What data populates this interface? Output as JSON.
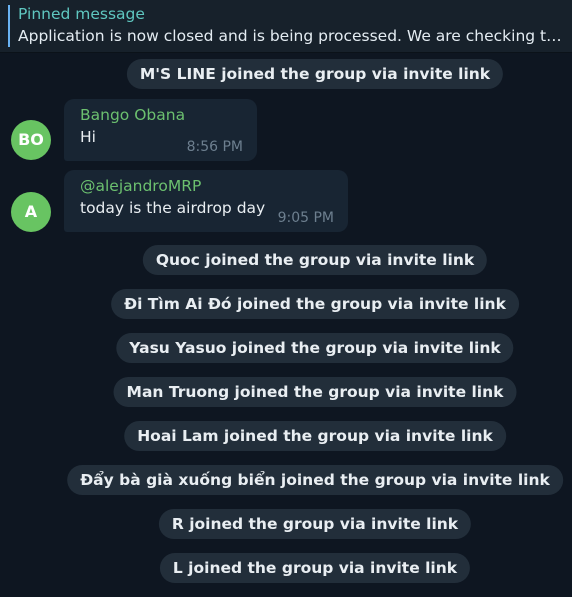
{
  "pinned": {
    "title": "Pinned message",
    "text": "Application is now closed and is being processed. We are checking the ..."
  },
  "service_messages": [
    "M'S LINE joined the group via invite link",
    "Quoc joined the group via invite link",
    "Đi Tìm Ai Đó joined the group via invite link",
    "Yasu Yasuo joined the group via invite link",
    "Man Truong joined the group via invite link",
    "Hoai Lam joined the group via invite link",
    "Đẩy bà già xuống biển joined the group via invite link",
    "R joined the group via invite link",
    "L joined the group via invite link"
  ],
  "messages": [
    {
      "avatar_initials": "BO",
      "sender": "Bango Obana",
      "text": "Hi",
      "time": "8:56 PM"
    },
    {
      "avatar_initials": "A",
      "sender": "@alejandroMRP",
      "text": "today is the airdrop day",
      "time": "9:05 PM"
    }
  ],
  "colors": {
    "background": "#0e1621",
    "pinned_title": "#5fc7c0",
    "sender_name": "#6cc06f",
    "avatar": "#68c462",
    "service_pill": "#222e3a"
  }
}
